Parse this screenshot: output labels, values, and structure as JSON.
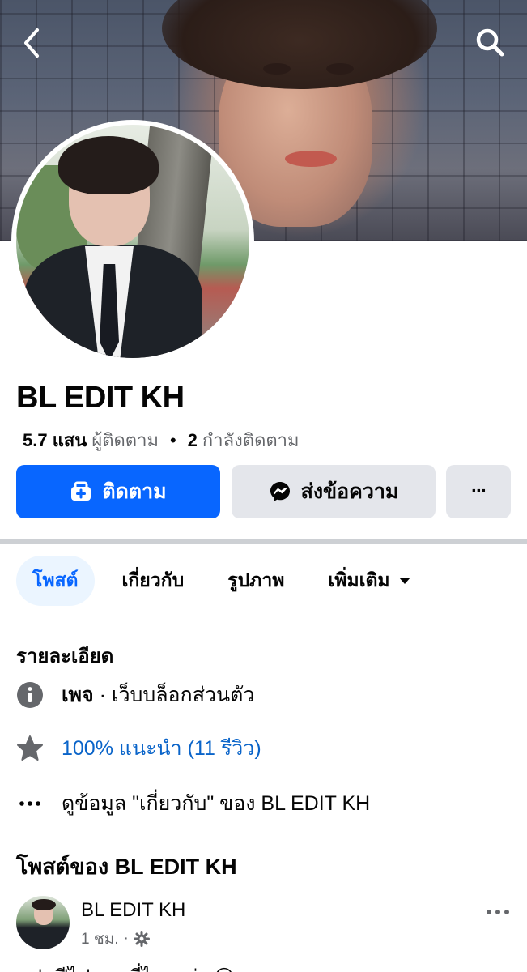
{
  "header": {
    "back_icon": "chevron-left-icon",
    "search_icon": "search-icon"
  },
  "profile": {
    "name": "BL EDIT KH",
    "followers_count": "5.7 แสน",
    "followers_label": "ผู้ติดตาม",
    "separator": "•",
    "following_count": "2",
    "following_label": "กำลังติดตาม"
  },
  "actions": {
    "follow_label": "ติดตาม",
    "message_label": "ส่งข้อความ",
    "more_label": "···"
  },
  "tabs": [
    {
      "label": "โพสต์",
      "active": true
    },
    {
      "label": "เกี่ยวกับ",
      "active": false
    },
    {
      "label": "รูปภาพ",
      "active": false
    },
    {
      "label": "เพิ่มเติม",
      "active": false
    }
  ],
  "details": {
    "title": "รายละเอียด",
    "page_type_bold": "เพจ",
    "page_type_rest": " · เว็บบล็อกส่วนตัว",
    "recommend": "100% แนะนำ (11 รีวิว)",
    "about_link": "ดูข้อมูล \"เกี่ยวกับ\" ของ BL EDIT KH"
  },
  "posts": {
    "title": "โพสต์ของ BL EDIT KH",
    "items": [
      {
        "author": "BL EDIT KH",
        "time": "1 ชม.",
        "dot": "·",
        "text": "แฟนปีไปทาง ที่ไกลกว่า 😢"
      }
    ]
  },
  "colors": {
    "accent": "#0866ff",
    "button_secondary": "#e4e6eb",
    "link": "#0a64c9",
    "muted_text": "#65676b"
  }
}
